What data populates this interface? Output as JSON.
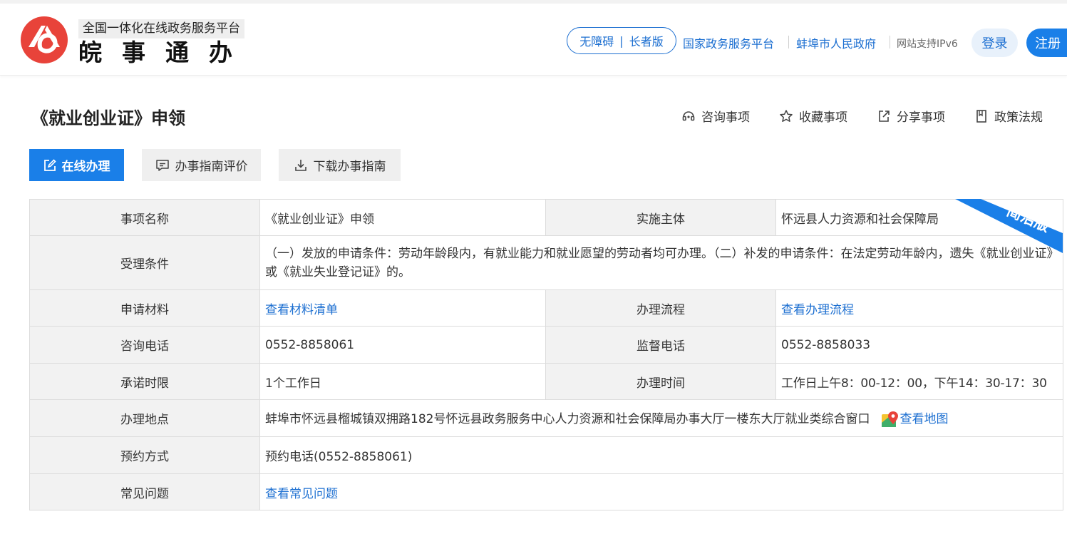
{
  "header": {
    "slogan": "全国一体化在线政务服务平台",
    "brand": "皖事通办",
    "accessibility": "无障碍",
    "elder": "长者版",
    "national_link": "国家政务服务平台",
    "city_link": "蚌埠市人民政府",
    "ipv6": "网站支持IPv6",
    "login": "登录",
    "register": "注册"
  },
  "page": {
    "title": "《就业创业证》申领",
    "actions": {
      "consult": "咨询事项",
      "favorite": "收藏事项",
      "share": "分享事项",
      "policy": "政策法规"
    },
    "buttons": {
      "online": "在线办理",
      "evaluate": "办事指南评价",
      "download": "下载办事指南"
    },
    "ribbon": "简洁版"
  },
  "table": {
    "item_name_label": "事项名称",
    "item_name": "《就业创业证》申领",
    "subject_label": "实施主体",
    "subject": "怀远县人力资源和社会保障局",
    "conditions_label": "受理条件",
    "conditions": "（一）发放的申请条件：劳动年龄段内，有就业能力和就业愿望的劳动者均可办理。（二）补发的申请条件：在法定劳动年龄内，遗失《就业创业证》或《就业失业登记证》的。",
    "materials_label": "申请材料",
    "materials_link": "查看材料清单",
    "process_label": "办理流程",
    "process_link": "查看办理流程",
    "consult_phone_label": "咨询电话",
    "consult_phone": "0552-8858061",
    "supervise_phone_label": "监督电话",
    "supervise_phone": "0552-8858033",
    "promise_label": "承诺时限",
    "promise": "1个工作日",
    "hours_label": "办理时间",
    "hours": "工作日上午8：00-12：00，下午14：30-17：30",
    "location_label": "办理地点",
    "location": "蚌埠市怀远县榴城镇双拥路182号怀远县政务服务中心人力资源和社会保障局办事大厅一楼东大厅就业类综合窗口",
    "map_link": "查看地图",
    "booking_label": "预约方式",
    "booking": "预约电话(0552-8858061)",
    "faq_label": "常见问题",
    "faq_link": "查看常见问题"
  },
  "colors": {
    "brand_red": "#e8433a",
    "primary_blue": "#1a7fe8",
    "link_blue": "#1c6fd1"
  },
  "icons": [
    "logo-icon",
    "headset-icon",
    "star-icon",
    "share-icon",
    "book-icon",
    "edit-icon",
    "comment-icon",
    "download-icon",
    "map-pin-icon"
  ]
}
